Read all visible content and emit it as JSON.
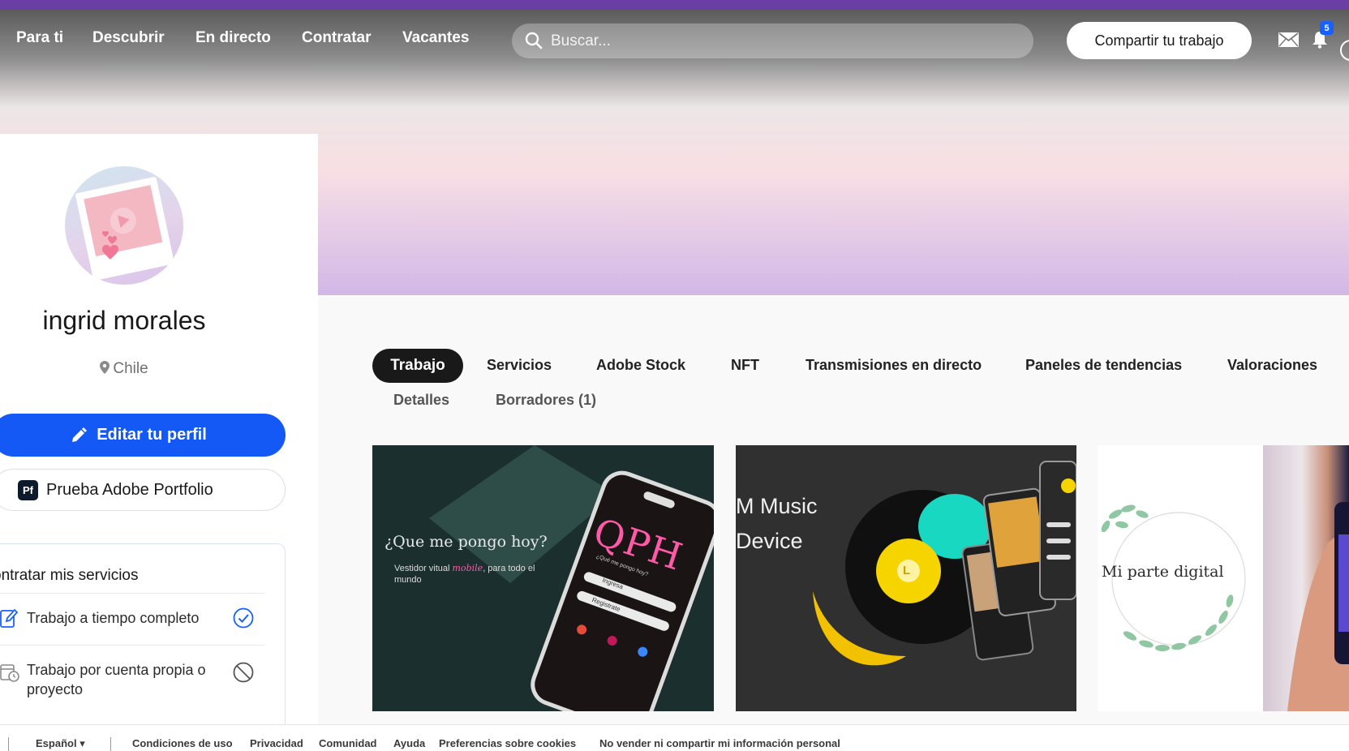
{
  "nav": {
    "links": [
      "Para ti",
      "Descubrir",
      "En directo",
      "Contratar",
      "Vacantes"
    ],
    "search_placeholder": "Buscar...",
    "share_label": "Compartir tu trabajo",
    "notification_count": "5",
    "accent_color": "#6a3fa3"
  },
  "profile": {
    "name": "ingrid morales",
    "location": "Chile",
    "edit_label": "Editar tu perfil",
    "portfolio_label": "Prueba Adobe Portfolio",
    "portfolio_logo": "Pf"
  },
  "services": {
    "title": "ontratar mis servicios",
    "items": [
      {
        "label": "Trabajo a tiempo completo",
        "icon": "edit-pen-icon",
        "status": "check-circle-icon"
      },
      {
        "label_line1": "Trabajo por cuenta propia o",
        "label_line2": "proyecto",
        "icon": "calendar-clock-icon",
        "status": "prohibited-icon"
      }
    ]
  },
  "tabs": {
    "active": "Trabajo",
    "items": [
      "Servicios",
      "Adobe Stock",
      "NFT",
      "Transmisiones en directo",
      "Paneles de tendencias",
      "Valoraciones"
    ],
    "sub_items": [
      "Detalles",
      "Borradores (1)"
    ]
  },
  "projects": {
    "card1": {
      "heading": "¿Que me pongo hoy?",
      "subtitle_a": "Vestidor vitual ",
      "subtitle_b": "mobile",
      "subtitle_c": ", para todo el",
      "subtitle_d": "mundo",
      "logo": "QPH",
      "screen_tagline": "¿Qué me pongo hoy?",
      "btn1": "Ingresa",
      "btn2": "Registrate"
    },
    "card2": {
      "line1": "M Music",
      "line2": "Device",
      "disc_letter": "L"
    },
    "card3": {
      "text": "Mi parte digital"
    }
  },
  "footer": {
    "language": "Español",
    "links": [
      "Condiciones de uso",
      "Privacidad",
      "Comunidad",
      "Ayuda",
      "Preferencias sobre cookies",
      "No vender ni compartir mi información personal"
    ]
  }
}
